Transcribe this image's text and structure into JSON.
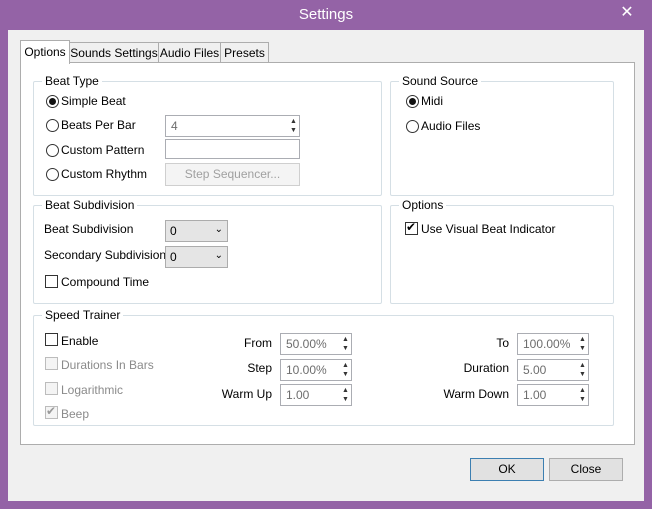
{
  "window": {
    "title": "Settings",
    "close_glyph": "✕"
  },
  "tabs": [
    "Options",
    "Sounds Settings",
    "Audio Files",
    "Presets"
  ],
  "beat_type": {
    "label": "Beat Type",
    "simple_beat": "Simple Beat",
    "beats_per_bar": "Beats Per Bar",
    "beats_per_bar_value": "4",
    "custom_pattern": "Custom Pattern",
    "custom_pattern_value": "",
    "custom_rhythm": "Custom Rhythm",
    "step_sequencer": "Step Sequencer..."
  },
  "sound_source": {
    "label": "Sound Source",
    "midi": "Midi",
    "audio_files": "Audio Files"
  },
  "beat_subdivision": {
    "label": "Beat Subdivision",
    "beat_subdivision_label": "Beat Subdivision",
    "beat_subdivision_value": "0",
    "secondary_label": "Secondary Subdivision",
    "secondary_value": "0",
    "compound_time": "Compound Time"
  },
  "options": {
    "label": "Options",
    "visual_beat": "Use Visual Beat Indicator"
  },
  "speed_trainer": {
    "label": "Speed Trainer",
    "enable": "Enable",
    "durations_in_bars": "Durations In Bars",
    "logarithmic": "Logarithmic",
    "beep": "Beep",
    "from_label": "From",
    "from_value": "50.00%",
    "step_label": "Step",
    "step_value": "10.00%",
    "warmup_label": "Warm Up",
    "warmup_value": "1.00",
    "to_label": "To",
    "to_value": "100.00%",
    "duration_label": "Duration",
    "duration_value": "5.00",
    "warmdown_label": "Warm Down",
    "warmdown_value": "1.00"
  },
  "footer": {
    "ok": "OK",
    "close": "Close"
  },
  "icons": {
    "tick": "✔",
    "spin_up": "▲",
    "spin_down": "▼",
    "dropdown": "⌄"
  },
  "colors": {
    "titlebar": "#9463a6",
    "client": "#f0f0f0",
    "panel": "#ffffff"
  }
}
